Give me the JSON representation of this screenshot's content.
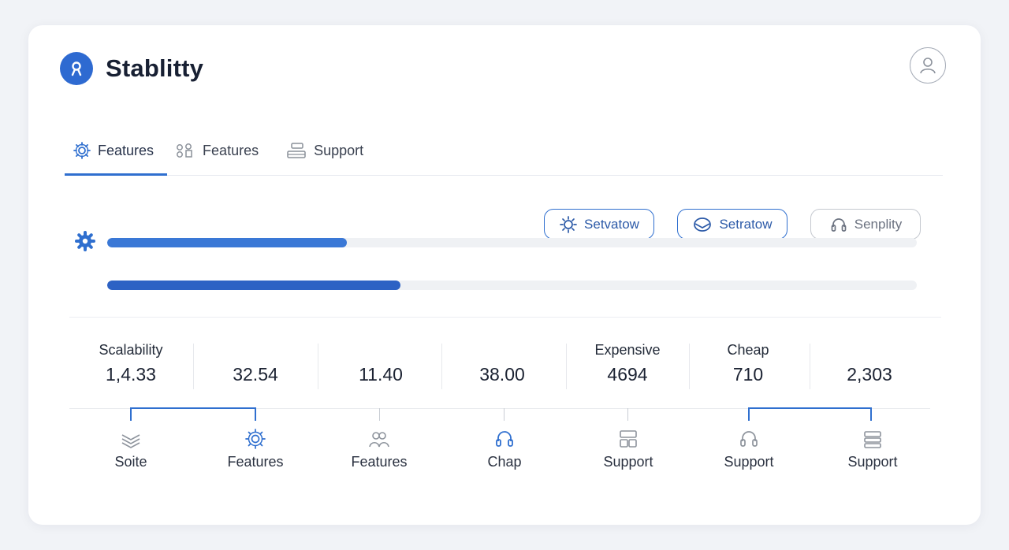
{
  "app": {
    "title": "Stablitty"
  },
  "tabs": [
    {
      "label": "Features",
      "icon": "gear-icon",
      "active": true
    },
    {
      "label": "Features",
      "icon": "nodes-icon",
      "active": false
    },
    {
      "label": "Support",
      "icon": "layers-icon",
      "active": false
    }
  ],
  "pills": [
    {
      "label": "Setvatow",
      "icon": "sun-icon",
      "style": "primary"
    },
    {
      "label": "Setratow",
      "icon": "badge-icon",
      "style": "primary"
    },
    {
      "label": "Senplity",
      "icon": "headset-icon",
      "style": "muted"
    }
  ],
  "progress": [
    {
      "value": 0.296,
      "color": "#3a78d6"
    },
    {
      "value": 0.362,
      "color": "#2d62c4"
    }
  ],
  "stats": [
    {
      "label": "Scalability",
      "value": "1,4.33"
    },
    {
      "label": "",
      "value": "32.54"
    },
    {
      "label": "",
      "value": "11.40"
    },
    {
      "label": "",
      "value": "38.00"
    },
    {
      "label": "Expensive",
      "value": "4694"
    },
    {
      "label": "Cheap",
      "value": "710"
    },
    {
      "label": "",
      "value": "2,303"
    }
  ],
  "bottom_items": [
    {
      "label": "Soite",
      "icon": "stack-icon"
    },
    {
      "label": "Features",
      "icon": "gear-icon"
    },
    {
      "label": "Features",
      "icon": "users-icon"
    },
    {
      "label": "Chap",
      "icon": "headset-icon"
    },
    {
      "label": "Support",
      "icon": "grid-icon"
    },
    {
      "label": "Support",
      "icon": "headset-icon"
    },
    {
      "label": "Support",
      "icon": "list-icon"
    }
  ],
  "colors": {
    "accent": "#2f6fcf",
    "logo": "#2e6ad1",
    "background": "#f1f3f7"
  }
}
